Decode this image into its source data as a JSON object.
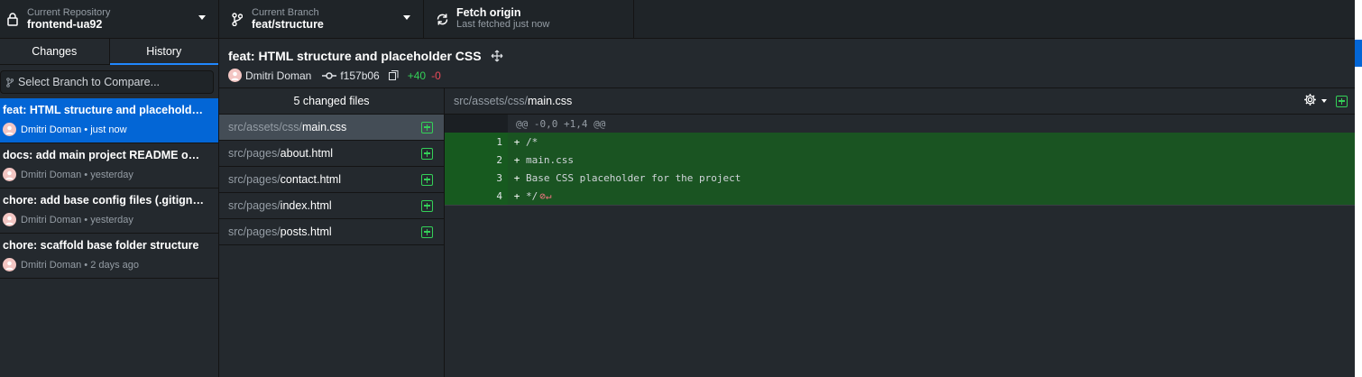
{
  "toolbar": {
    "repo_label": "Current Repository",
    "repo_value": "frontend-ua92",
    "branch_label": "Current Branch",
    "branch_value": "feat/structure",
    "fetch_label": "Fetch origin",
    "fetch_sub": "Last fetched just now"
  },
  "sidebar": {
    "tabs": [
      "Changes",
      "History"
    ],
    "active_tab": "History",
    "compare_placeholder": "Select Branch to Compare...",
    "commits": [
      {
        "title": "feat: HTML structure and placeholder CSS",
        "author": "Dmitri Doman",
        "time": "just now"
      },
      {
        "title": "docs: add main project README overview",
        "author": "Dmitri Doman",
        "time": "yesterday"
      },
      {
        "title": "chore: add base config files (.gitignore)",
        "author": "Dmitri Doman",
        "time": "yesterday"
      },
      {
        "title": "chore: scaffold base folder structure",
        "author": "Dmitri Doman",
        "time": "2 days ago"
      }
    ]
  },
  "commit": {
    "title": "feat: HTML structure and placeholder CSS",
    "author": "Dmitri Doman",
    "sha": "f157b06",
    "additions": "+40",
    "deletions": "-0"
  },
  "files": {
    "header": "5 changed files",
    "items": [
      {
        "dir": "src/assets/css/",
        "name": "main.css"
      },
      {
        "dir": "src/pages/",
        "name": "about.html"
      },
      {
        "dir": "src/pages/",
        "name": "contact.html"
      },
      {
        "dir": "src/pages/",
        "name": "index.html"
      },
      {
        "dir": "src/pages/",
        "name": "posts.html"
      }
    ]
  },
  "diff": {
    "dir": "src/assets/css/",
    "name": "main.css",
    "hunk": "@@ -0,0 +1,4 @@",
    "lines": [
      {
        "num": "1",
        "sign": "+",
        "code": "/*"
      },
      {
        "num": "2",
        "sign": "+",
        "code": "main.css"
      },
      {
        "num": "3",
        "sign": "+",
        "code": "Base CSS placeholder for the project"
      },
      {
        "num": "4",
        "sign": "+",
        "code": "*/"
      }
    ]
  },
  "colors": {
    "accent": "#0366d6",
    "added": "#34d058",
    "deleted": "#ea4a5a"
  },
  "icons": {
    "repo": "lock-icon",
    "branch": "git-branch-icon",
    "fetch": "sync-icon"
  }
}
